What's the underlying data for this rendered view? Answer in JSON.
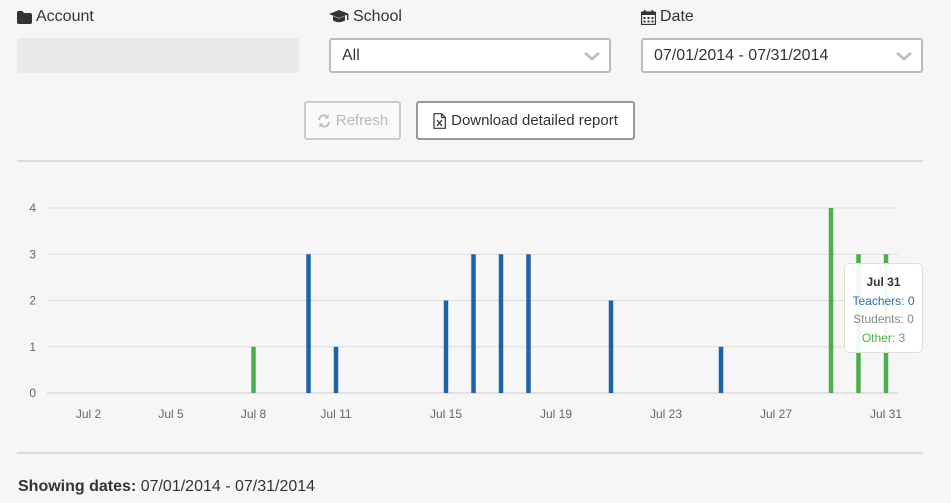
{
  "filters": {
    "account": {
      "label": "Account",
      "icon": "folder-icon",
      "value": ""
    },
    "school": {
      "label": "School",
      "icon": "graduation-cap-icon",
      "value": "All"
    },
    "date": {
      "label": "Date",
      "icon": "calendar-icon",
      "value": "07/01/2014 - 07/31/2014"
    }
  },
  "actions": {
    "refresh_label": "Refresh",
    "refresh_disabled": true,
    "download_label": "Download detailed report"
  },
  "colors": {
    "teachers": "#1f63a6",
    "students": "#888888",
    "other": "#4cae4c"
  },
  "chart_data": {
    "type": "bar",
    "stacked": true,
    "x_domain": [
      "Jul 1",
      "Jul 31"
    ],
    "x_ticks": [
      "Jul 2",
      "Jul 5",
      "Jul 8",
      "Jul 11",
      "Jul 15",
      "Jul 19",
      "Jul 23",
      "Jul 27",
      "Jul 31"
    ],
    "x_tick_days": [
      2,
      5,
      8,
      11,
      15,
      19,
      23,
      27,
      31
    ],
    "ylim": [
      0,
      4
    ],
    "y_ticks": [
      0,
      1,
      2,
      3,
      4
    ],
    "grid": true,
    "series": [
      {
        "name": "Teachers",
        "color": "#1f63a6",
        "points": [
          [
            10,
            3
          ],
          [
            11,
            1
          ],
          [
            15,
            2
          ],
          [
            16,
            3
          ],
          [
            17,
            3
          ],
          [
            18,
            3
          ],
          [
            21,
            2
          ],
          [
            25,
            1
          ]
        ]
      },
      {
        "name": "Students",
        "color": "#888888",
        "points": []
      },
      {
        "name": "Other",
        "color": "#4cae4c",
        "points": [
          [
            8,
            1
          ],
          [
            29,
            4
          ],
          [
            30,
            3
          ],
          [
            31,
            3
          ]
        ]
      }
    ]
  },
  "tooltip": {
    "title": "Jul 31",
    "teachers": "Teachers: 0",
    "students": "Students: 0",
    "other": "Other: 3"
  },
  "footer": {
    "showing_label": "Showing dates:",
    "showing_value": "07/01/2014 - 07/31/2014"
  }
}
